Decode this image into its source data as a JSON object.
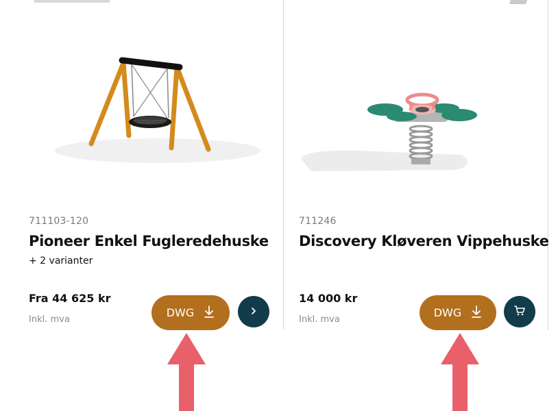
{
  "products": [
    {
      "sku": "711103-120",
      "title": "Pioneer Enkel Fugleredehuske",
      "variants": "+ 2 varianter",
      "price": "Fra  44 625 kr",
      "vat": "Inkl. mva",
      "dwg_label": "DWG",
      "dwg_icon": "download-icon",
      "action_icon": "chevron-right-icon"
    },
    {
      "sku": "711246",
      "title": "Discovery Kløveren Vippehuske",
      "price": "14 000 kr",
      "vat": "Inkl. mva",
      "dwg_label": "DWG",
      "dwg_icon": "download-icon",
      "action_icon": "cart-icon"
    }
  ],
  "colors": {
    "dwg_button": "#b26f1e",
    "round_button": "#123c4a",
    "annotation_arrow": "#e8606a"
  }
}
